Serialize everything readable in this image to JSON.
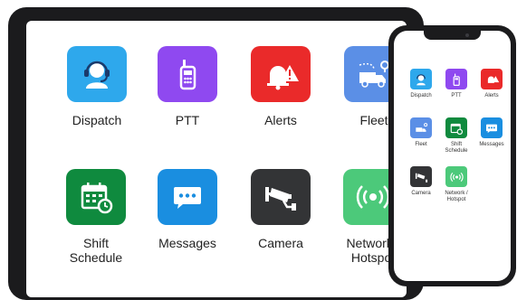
{
  "tablet": {
    "apps": [
      {
        "label": "Dispatch",
        "color": "#2ea8ec",
        "icon": "headset-agent-icon"
      },
      {
        "label": "PTT",
        "color": "#8f49f0",
        "icon": "walkie-talkie-icon"
      },
      {
        "label": "Alerts",
        "color": "#ea2a2a",
        "icon": "alarm-bell-icon"
      },
      {
        "label": "Fleet",
        "color": "#5b8fe6",
        "icon": "truck-route-icon"
      },
      {
        "label": "Shift\nSchedule",
        "color": "#0f8a3e",
        "icon": "calendar-clock-icon"
      },
      {
        "label": "Messages",
        "color": "#1a8ee0",
        "icon": "chat-bubble-icon"
      },
      {
        "label": "Camera",
        "color": "#333436",
        "icon": "security-camera-icon"
      },
      {
        "label": "Network /\nHotspot",
        "color": "#4cc97a",
        "icon": "wireless-signal-icon"
      }
    ]
  },
  "phone": {
    "apps": [
      {
        "label": "Dispatch",
        "color": "#2ea8ec",
        "icon": "headset-agent-icon"
      },
      {
        "label": "PTT",
        "color": "#8f49f0",
        "icon": "walkie-talkie-icon"
      },
      {
        "label": "Alerts",
        "color": "#ea2a2a",
        "icon": "alarm-bell-icon"
      },
      {
        "label": "Fleet",
        "color": "#5b8fe6",
        "icon": "truck-route-icon"
      },
      {
        "label": "Shift\nSchedule",
        "color": "#0f8a3e",
        "icon": "calendar-clock-icon"
      },
      {
        "label": "Messages",
        "color": "#1a8ee0",
        "icon": "chat-bubble-icon"
      },
      {
        "label": "Camera",
        "color": "#333436",
        "icon": "security-camera-icon"
      },
      {
        "label": "Network /\nHotspot",
        "color": "#4cc97a",
        "icon": "wireless-signal-icon"
      }
    ]
  }
}
